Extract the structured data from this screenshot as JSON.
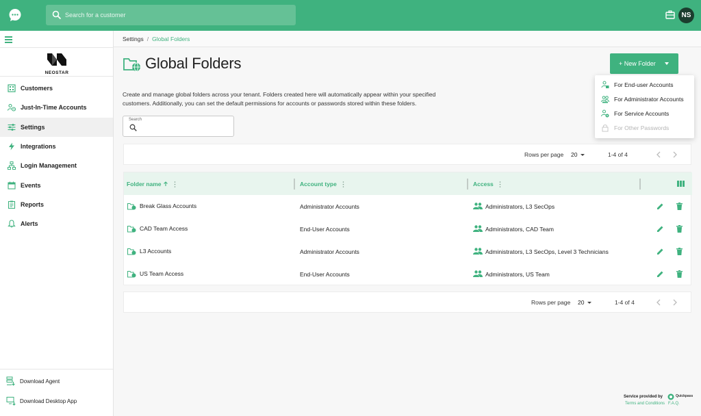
{
  "colors": {
    "accent": "#3fb27f",
    "dark": "#1b3d2e",
    "header_bg": "#e8f5ee"
  },
  "topbar": {
    "logo_icon": "chat-bubble-icon",
    "search_placeholder": "Search for a customer",
    "user_initials": "NS"
  },
  "sidebar": {
    "brand_name": "NEOSTAR",
    "items": [
      {
        "label": "Customers",
        "icon": "building-icon"
      },
      {
        "label": "Just-In-Time Accounts",
        "icon": "users-clock-icon"
      },
      {
        "label": "Settings",
        "icon": "sliders-icon",
        "active": true
      },
      {
        "label": "Integrations",
        "icon": "lightning-icon"
      },
      {
        "label": "Login Management",
        "icon": "network-icon"
      },
      {
        "label": "Events",
        "icon": "calendar-icon"
      },
      {
        "label": "Reports",
        "icon": "clipboard-icon"
      },
      {
        "label": "Alerts",
        "icon": "bell-icon"
      }
    ],
    "bottom": [
      {
        "label": "Download Agent",
        "icon": "server-download-icon"
      },
      {
        "label": "Download Desktop App",
        "icon": "monitor-download-icon"
      }
    ]
  },
  "breadcrumb": {
    "parent": "Settings",
    "separator": "/",
    "current": "Global Folders"
  },
  "page": {
    "title": "Global Folders",
    "description": "Create and manage global folders across your tenant. Folders created here will automatically appear within your specified customers. Additionally, you can set the default permissions for accounts or passwords stored within these folders."
  },
  "new_folder": {
    "label": "+ New Folder",
    "options": [
      {
        "label": "For End-user Accounts",
        "disabled": false
      },
      {
        "label": "For Administrator Accounts",
        "disabled": false
      },
      {
        "label": "For Service Accounts",
        "disabled": false
      },
      {
        "label": "For Other Passwords",
        "disabled": true
      }
    ]
  },
  "search": {
    "label": "Search"
  },
  "pager": {
    "rows_label": "Rows per page",
    "rows_value": "20",
    "range": "1-4 of 4"
  },
  "table": {
    "headers": {
      "folder": "Folder name",
      "type": "Account type",
      "access": "Access"
    },
    "rows": [
      {
        "folder": "Break Glass Accounts",
        "type": "Administrator Accounts",
        "access": "Administrators, L3 SecOps"
      },
      {
        "folder": "CAD Team Access",
        "type": "End-User Accounts",
        "access": "Administrators, CAD Team"
      },
      {
        "folder": "L3 Accounts",
        "type": "Administrator Accounts",
        "access": "Administrators, L3 SecOps, Level 3 Technicians"
      },
      {
        "folder": "US Team Access",
        "type": "End-User Accounts",
        "access": "Administrators, US Team"
      }
    ]
  },
  "footer": {
    "provided": "Service provided by",
    "brand": "Quickpass",
    "links": [
      "Terms and Conditions",
      "F.A.Q."
    ]
  }
}
